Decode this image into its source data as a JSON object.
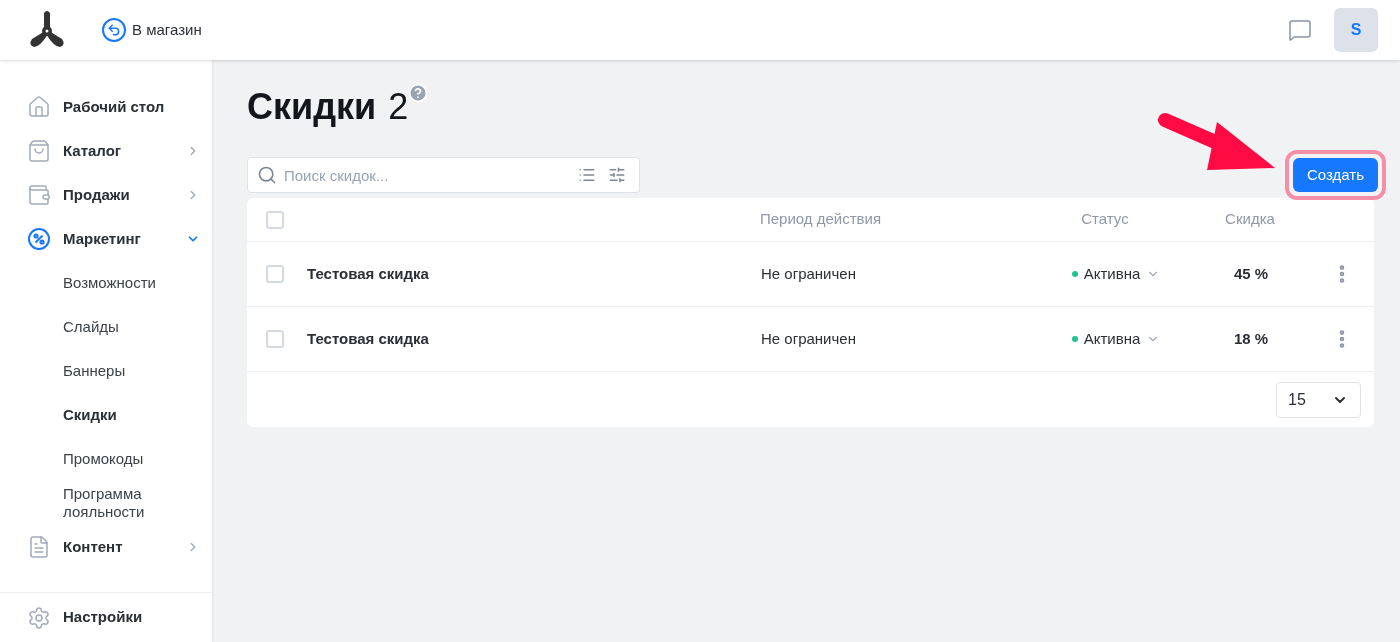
{
  "header": {
    "back_link": "В магазин",
    "avatar": "S"
  },
  "sidebar": {
    "items": [
      {
        "label": "Рабочий стол",
        "kind": "link",
        "selected": false
      },
      {
        "label": "Каталог",
        "kind": "group",
        "expanded": false,
        "selected": false
      },
      {
        "label": "Продажи",
        "kind": "group",
        "expanded": false,
        "selected": false
      },
      {
        "label": "Маркетинг",
        "kind": "group",
        "expanded": true,
        "selected": true,
        "children": [
          {
            "label": "Возможности",
            "selected": false
          },
          {
            "label": "Слайды",
            "selected": false
          },
          {
            "label": "Баннеры",
            "selected": false
          },
          {
            "label": "Скидки",
            "selected": true
          },
          {
            "label": "Промокоды",
            "selected": false
          },
          {
            "label": "Программа лояльности",
            "selected": false
          }
        ]
      },
      {
        "label": "Контент",
        "kind": "group",
        "expanded": false,
        "selected": false
      }
    ],
    "footer_item": "Настройки"
  },
  "page": {
    "title": "Скидки",
    "count": "2"
  },
  "search": {
    "placeholder": "Поиск скидок..."
  },
  "create_button": "Создать",
  "table": {
    "header_checked": false,
    "columns": [
      "Период действия",
      "Статус",
      "Скидка"
    ],
    "rows": [
      {
        "checked": false,
        "name": "Тестовая скидка",
        "period": "Не ограничен",
        "status": "Активна",
        "color": "#22c38e",
        "discount": "45 %"
      },
      {
        "checked": false,
        "name": "Тестовая скидка",
        "period": "Не ограничен",
        "status": "Активна",
        "color": "#22c38e",
        "discount": "18 %"
      }
    ]
  },
  "page_size": "15"
}
